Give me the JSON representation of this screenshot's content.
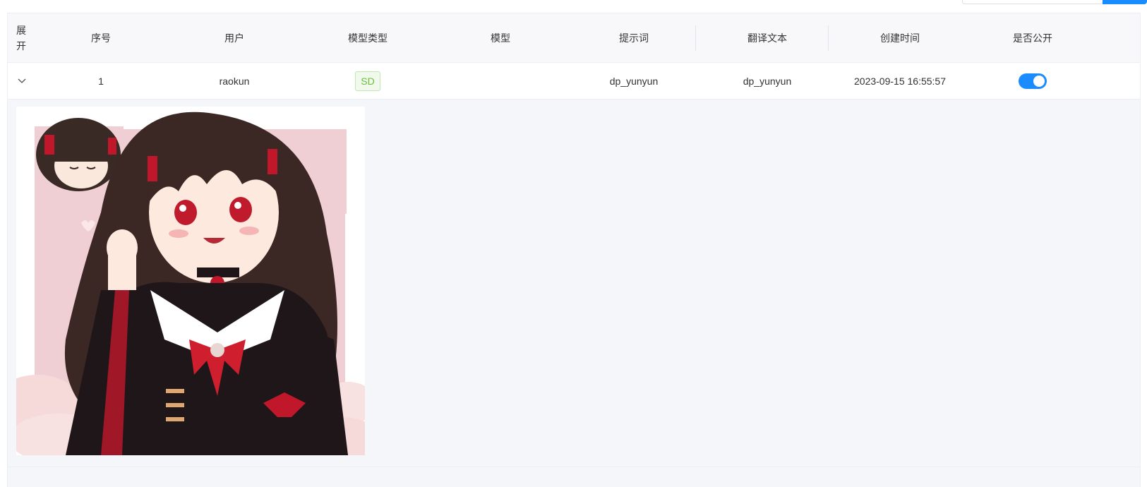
{
  "table": {
    "headers": {
      "expand": "展开",
      "index": "序号",
      "user": "用户",
      "model_type": "模型类型",
      "model": "模型",
      "prompt": "提示词",
      "translation": "翻译文本",
      "created_at": "创建时间",
      "is_public": "是否公开"
    },
    "rows": [
      {
        "index": "1",
        "user": "raokun",
        "model_type": "SD",
        "model": "",
        "prompt": "dp_yunyun",
        "translation": "dp_yunyun",
        "created_at": "2023-09-15 16:55:57",
        "is_public": true
      }
    ]
  },
  "colors": {
    "accent": "#1a8cff",
    "tag_text": "#67c23a",
    "tag_bg": "#f0f9eb",
    "header_bg": "#f8f8fa",
    "expanded_bg": "#f5f6f9"
  },
  "icons": {
    "expand": "chevron-down-icon"
  }
}
